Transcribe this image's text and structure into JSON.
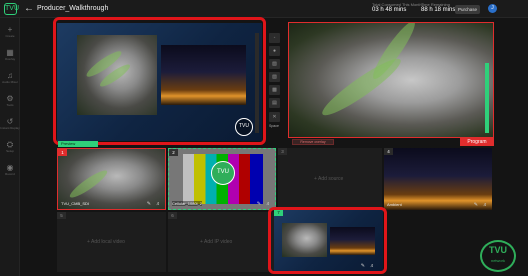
{
  "app": {
    "logo_text": "TVU",
    "back_icon": "arrow-left-icon",
    "title": "Producer_Walkthrough",
    "consumed_label": "Total Consumed This Month",
    "consumed_value": "03 h 48 mins",
    "remaining_label": "Time Remaining",
    "remaining_value": "88 h 18 mins",
    "purchase_label": "Purchase",
    "avatar_letter": "J"
  },
  "sidebar": {
    "items": [
      {
        "label": "Create",
        "icon": "plus-icon"
      },
      {
        "label": "Overlay",
        "icon": "overlay-icon"
      },
      {
        "label": "Audio Mixer",
        "icon": "audio-icon"
      },
      {
        "label": "Tools",
        "icon": "tools-icon"
      },
      {
        "label": "Instant Replay",
        "icon": "replay-icon"
      },
      {
        "label": "Setup",
        "icon": "gear-icon"
      },
      {
        "label": "Record",
        "icon": "record-icon"
      }
    ]
  },
  "preview": {
    "label": "Preview",
    "logo": "TVU"
  },
  "program": {
    "label": "Program",
    "overlay_button": "Remove overlay"
  },
  "transition_tools": [
    "Cut",
    "Auto",
    "Wipe",
    "Fade",
    "Mix",
    "Layout",
    "Space"
  ],
  "sources": [
    {
      "num": "1",
      "label": "TVU_CMB_SDI",
      "state": "program"
    },
    {
      "num": "2",
      "label": "Cellular_1080i_2",
      "state": "preview"
    },
    {
      "num": "3",
      "label": "+ Add source",
      "state": "empty"
    },
    {
      "num": "4",
      "label": "Ambient",
      "state": "idle"
    },
    {
      "num": "5",
      "label": "+ Add local video",
      "state": "empty"
    },
    {
      "num": "6",
      "label": "+ Add IP video",
      "state": "empty"
    },
    {
      "num": "7",
      "label": "",
      "state": "pip"
    }
  ],
  "watermark": {
    "text": "TVU",
    "sub": "network"
  },
  "colors": {
    "accent": "#2fd07a",
    "highlight": "#e0151a",
    "program": "#e02d2d",
    "preview": "#2fd07a"
  }
}
